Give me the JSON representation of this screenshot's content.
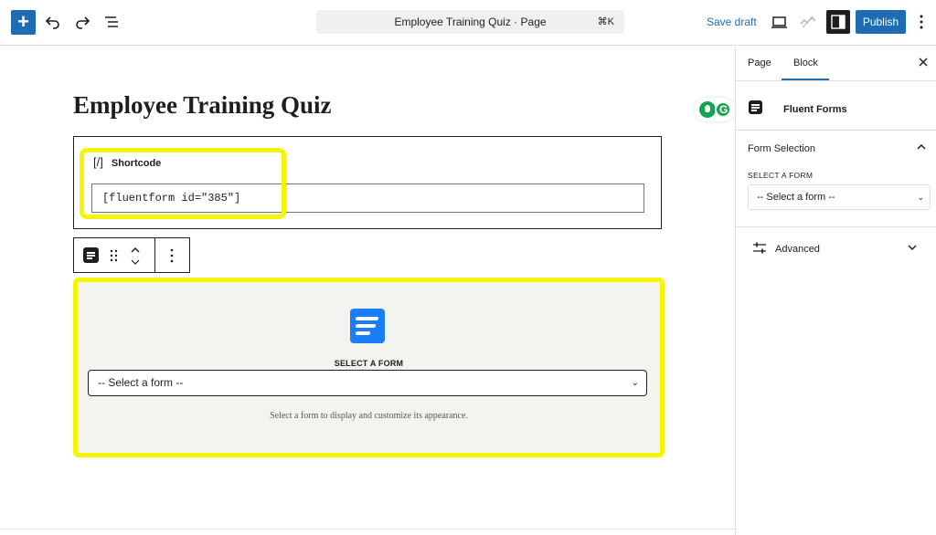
{
  "topbar": {
    "add_label": "+",
    "document_title": "Employee Training Quiz · Page",
    "shortcut": "⌘K",
    "save_draft": "Save draft",
    "publish": "Publish"
  },
  "editor": {
    "page_title": "Employee Training Quiz",
    "shortcode_block": {
      "heading": "Shortcode",
      "icon_glyph": "[/]",
      "value": "[fluentform id=\"385\"]"
    },
    "form_block": {
      "label": "SELECT A FORM",
      "selected": "-- Select a form --",
      "help": "Select a form to display and customize its appearance."
    }
  },
  "sidebar": {
    "tabs": [
      "Page",
      "Block"
    ],
    "active_tab": "Block",
    "block_name": "Fluent Forms",
    "section_title": "Form Selection",
    "field_label": "SELECT A FORM",
    "field_value": "-- Select a form --",
    "advanced": "Advanced"
  },
  "colors": {
    "accent": "#1d6cb4",
    "highlight": "#f5f500",
    "fluent_blue": "#1a7efb",
    "extension_green": "#15a44f"
  },
  "icons": [
    "plus-icon",
    "undo-icon",
    "redo-icon",
    "list-view-icon",
    "desktop-view-icon",
    "performance-icon",
    "settings-panel-icon",
    "more-vertical-icon",
    "close-icon",
    "chevron-up-icon",
    "chevron-down-icon",
    "drag-handle-icon",
    "fluent-forms-icon",
    "sliders-icon"
  ]
}
